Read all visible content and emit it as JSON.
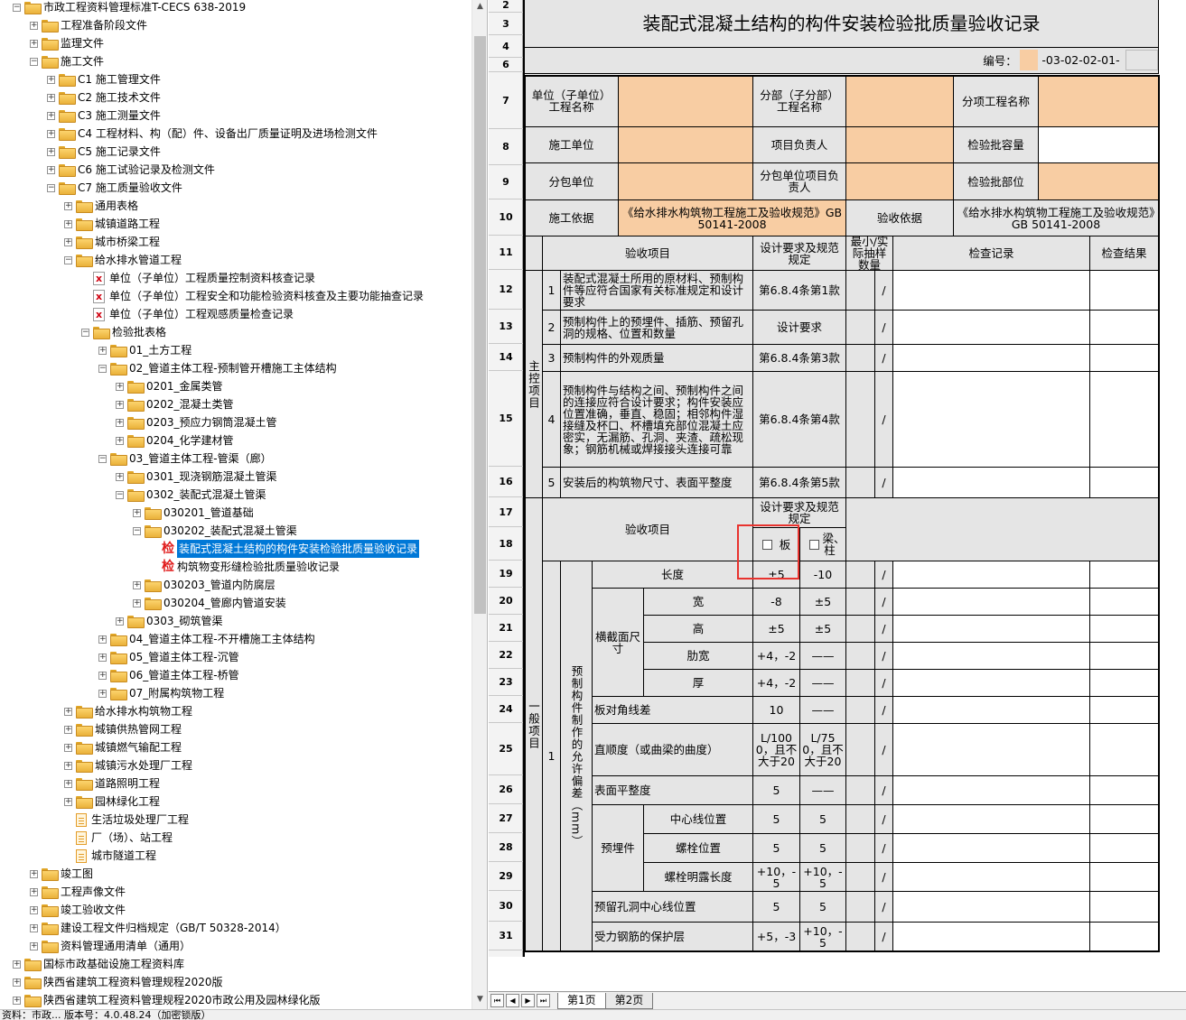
{
  "tree": {
    "items": [
      {
        "label": "市政工程资料管理标准T-CECS 638-2019",
        "depth": 0,
        "exp": "-",
        "icon": "folder"
      },
      {
        "label": "工程准备阶段文件",
        "depth": 1,
        "exp": "+",
        "icon": "folder"
      },
      {
        "label": "监理文件",
        "depth": 1,
        "exp": "+",
        "icon": "folder"
      },
      {
        "label": "施工文件",
        "depth": 1,
        "exp": "-",
        "icon": "folder"
      },
      {
        "label": "C1 施工管理文件",
        "depth": 2,
        "exp": "+",
        "icon": "folder"
      },
      {
        "label": "C2 施工技术文件",
        "depth": 2,
        "exp": "+",
        "icon": "folder"
      },
      {
        "label": "C3 施工测量文件",
        "depth": 2,
        "exp": "+",
        "icon": "folder"
      },
      {
        "label": "C4 工程材料、构（配）件、设备出厂质量证明及进场检测文件",
        "depth": 2,
        "exp": "+",
        "icon": "folder"
      },
      {
        "label": "C5 施工记录文件",
        "depth": 2,
        "exp": "+",
        "icon": "folder"
      },
      {
        "label": "C6 施工试验记录及检测文件",
        "depth": 2,
        "exp": "+",
        "icon": "folder"
      },
      {
        "label": "C7 施工质量验收文件",
        "depth": 2,
        "exp": "-",
        "icon": "folder"
      },
      {
        "label": "通用表格",
        "depth": 3,
        "exp": "+",
        "icon": "folder"
      },
      {
        "label": "城镇道路工程",
        "depth": 3,
        "exp": "+",
        "icon": "folder"
      },
      {
        "label": "城市桥梁工程",
        "depth": 3,
        "exp": "+",
        "icon": "folder"
      },
      {
        "label": "给水排水管道工程",
        "depth": 3,
        "exp": "-",
        "icon": "folder"
      },
      {
        "label": "单位（子单位）工程质量控制资料核查记录",
        "depth": 4,
        "exp": "",
        "icon": "docx"
      },
      {
        "label": "单位（子单位）工程安全和功能检验资料核查及主要功能抽查记录",
        "depth": 4,
        "exp": "",
        "icon": "docx"
      },
      {
        "label": "单位（子单位）工程观感质量检查记录",
        "depth": 4,
        "exp": "",
        "icon": "docx"
      },
      {
        "label": "检验批表格",
        "depth": 4,
        "exp": "-",
        "icon": "folder"
      },
      {
        "label": "01_土方工程",
        "depth": 5,
        "exp": "+",
        "icon": "folder"
      },
      {
        "label": "02_管道主体工程-预制管开槽施工主体结构",
        "depth": 5,
        "exp": "-",
        "icon": "folder"
      },
      {
        "label": "0201_金属类管",
        "depth": 6,
        "exp": "+",
        "icon": "folder"
      },
      {
        "label": "0202_混凝土类管",
        "depth": 6,
        "exp": "+",
        "icon": "folder"
      },
      {
        "label": "0203_预应力钢筒混凝土管",
        "depth": 6,
        "exp": "+",
        "icon": "folder"
      },
      {
        "label": "0204_化学建材管",
        "depth": 6,
        "exp": "+",
        "icon": "folder"
      },
      {
        "label": "03_管道主体工程-管渠（廊）",
        "depth": 5,
        "exp": "-",
        "icon": "folder"
      },
      {
        "label": "0301_现浇钢筋混凝土管渠",
        "depth": 6,
        "exp": "+",
        "icon": "folder"
      },
      {
        "label": "0302_装配式混凝土管渠",
        "depth": 6,
        "exp": "-",
        "icon": "folder"
      },
      {
        "label": "030201_管道基础",
        "depth": 7,
        "exp": "+",
        "icon": "folder"
      },
      {
        "label": "030202_装配式混凝土管渠",
        "depth": 7,
        "exp": "-",
        "icon": "folder"
      },
      {
        "label": "装配式混凝土结构的构件安装检验批质量验收记录",
        "depth": 8,
        "exp": "",
        "icon": "jian",
        "selected": true
      },
      {
        "label": "构筑物变形缝检验批质量验收记录",
        "depth": 8,
        "exp": "",
        "icon": "jian"
      },
      {
        "label": "030203_管道内防腐层",
        "depth": 7,
        "exp": "+",
        "icon": "folder"
      },
      {
        "label": "030204_管廊内管道安装",
        "depth": 7,
        "exp": "+",
        "icon": "folder"
      },
      {
        "label": "0303_砌筑管渠",
        "depth": 6,
        "exp": "+",
        "icon": "folder"
      },
      {
        "label": "04_管道主体工程-不开槽施工主体结构",
        "depth": 5,
        "exp": "+",
        "icon": "folder"
      },
      {
        "label": "05_管道主体工程-沉管",
        "depth": 5,
        "exp": "+",
        "icon": "folder"
      },
      {
        "label": "06_管道主体工程-桥管",
        "depth": 5,
        "exp": "+",
        "icon": "folder"
      },
      {
        "label": "07_附属构筑物工程",
        "depth": 5,
        "exp": "+",
        "icon": "folder"
      },
      {
        "label": "给水排水构筑物工程",
        "depth": 3,
        "exp": "+",
        "icon": "folder"
      },
      {
        "label": "城镇供热管网工程",
        "depth": 3,
        "exp": "+",
        "icon": "folder"
      },
      {
        "label": "城镇燃气输配工程",
        "depth": 3,
        "exp": "+",
        "icon": "folder"
      },
      {
        "label": "城镇污水处理厂工程",
        "depth": 3,
        "exp": "+",
        "icon": "folder"
      },
      {
        "label": "道路照明工程",
        "depth": 3,
        "exp": "+",
        "icon": "folder"
      },
      {
        "label": "园林绿化工程",
        "depth": 3,
        "exp": "+",
        "icon": "folder"
      },
      {
        "label": "生活垃圾处理厂工程",
        "depth": 3,
        "exp": "",
        "icon": "doc"
      },
      {
        "label": "厂（场）、站工程",
        "depth": 3,
        "exp": "",
        "icon": "doc"
      },
      {
        "label": "城市隧道工程",
        "depth": 3,
        "exp": "",
        "icon": "doc"
      },
      {
        "label": "竣工图",
        "depth": 1,
        "exp": "+",
        "icon": "folder"
      },
      {
        "label": "工程声像文件",
        "depth": 1,
        "exp": "+",
        "icon": "folder"
      },
      {
        "label": "竣工验收文件",
        "depth": 1,
        "exp": "+",
        "icon": "folder"
      },
      {
        "label": "建设工程文件归档规定（GB/T 50328-2014）",
        "depth": 1,
        "exp": "+",
        "icon": "folder"
      },
      {
        "label": "资料管理通用清单（通用）",
        "depth": 1,
        "exp": "+",
        "icon": "folder"
      },
      {
        "label": "国标市政基础设施工程资料库",
        "depth": 0,
        "exp": "+",
        "icon": "folder"
      },
      {
        "label": "陕西省建筑工程资料管理规程2020版",
        "depth": 0,
        "exp": "+",
        "icon": "folder"
      },
      {
        "label": "陕西省建筑工程资料管理规程2020市政公用及园林绿化版",
        "depth": 0,
        "exp": "+",
        "icon": "folder"
      }
    ]
  },
  "sheet": {
    "rows": [
      "2",
      "3",
      "4",
      "6",
      "7",
      "8",
      "9",
      "10",
      "11",
      "12",
      "13",
      "14",
      "15",
      "16",
      "17",
      "18",
      "19",
      "20",
      "21",
      "22",
      "23",
      "24",
      "25",
      "26",
      "27",
      "28",
      "29",
      "30",
      "31"
    ],
    "title": "装配式混凝土结构的构件安装检验批质量验收记录",
    "code_label": "编号：",
    "code_value": "-03-02-02-01-",
    "hdr": {
      "unit_name": "单位（子单位）工程名称",
      "sub_name": "分部（子分部）工程名称",
      "item_name": "分项工程名称",
      "contractor": "施工单位",
      "pm": "项目负责人",
      "lot_capacity": "检验批容量",
      "subcontractor": "分包单位",
      "sub_pm": "分包单位项目负责人",
      "lot_location": "检验批部位",
      "basis": "施工依据",
      "basis_value": "《给水排水构筑物工程施工及验收规范》GB 50141-2008",
      "acc_basis": "验收依据",
      "acc_basis_value": "《给水排水构筑物工程施工及验收规范》GB 50141-2008"
    },
    "cols": {
      "item": "验收项目",
      "req": "设计要求及规范规定",
      "sample": "最小/实际抽样数量",
      "record": "检查记录",
      "result": "检查结果"
    },
    "main_label": "主控项目",
    "general_label": "一般项目",
    "main": [
      {
        "no": "1",
        "text": "装配式混凝土所用的原材料、预制构件等应符合国家有关标准规定和设计要求",
        "req": "第6.8.4条第1款",
        "slash": "/"
      },
      {
        "no": "2",
        "text": "预制构件上的预埋件、插筋、预留孔洞的规格、位置和数量",
        "req": "设计要求",
        "slash": "/"
      },
      {
        "no": "3",
        "text": "预制构件的外观质量",
        "req": "第6.8.4条第3款",
        "slash": "/"
      },
      {
        "no": "4",
        "text": "预制构件与结构之间、预制构件之间的连接应符合设计要求；构件安装应位置准确，垂直、稳固；相邻构件湿接缝及杯口、杯槽填充部位混凝土应密实，无漏筋、孔洞、夹渣、疏松现象；钢筋机械或焊接接头连接可靠",
        "req": "第6.8.4条第4款",
        "slash": "/"
      },
      {
        "no": "5",
        "text": "安装后的构筑物尺寸、表面平整度",
        "req": "第6.8.4条第5款",
        "slash": "/"
      }
    ],
    "general": {
      "item_header": "验收项目",
      "req_header": "设计要求及规范规定",
      "plate": "板",
      "beam": "梁、柱",
      "no": "1",
      "group": "预制构件制作的允许偏差（mm）",
      "cross_section": "横截面尺寸",
      "embedded": "预埋件",
      "rows": [
        {
          "label": "长度",
          "a": "±5",
          "b": "-10",
          "slash": "/"
        },
        {
          "label": "宽",
          "a": "-8",
          "b": "±5",
          "slash": "/"
        },
        {
          "label": "高",
          "a": "±5",
          "b": "±5",
          "slash": "/"
        },
        {
          "label": "肋宽",
          "a": "+4，-2",
          "b": "——",
          "slash": "/"
        },
        {
          "label": "厚",
          "a": "+4，-2",
          "b": "——",
          "slash": "/"
        },
        {
          "label": "板对角线差",
          "a": "10",
          "b": "——",
          "slash": "/"
        },
        {
          "label": "直顺度（或曲梁的曲度）",
          "a": "L/1000，且不大于20",
          "b": "L/750，且不大于20",
          "slash": "/"
        },
        {
          "label": "表面平整度",
          "a": "5",
          "b": "——",
          "slash": "/"
        },
        {
          "label": "中心线位置",
          "a": "5",
          "b": "5",
          "slash": "/"
        },
        {
          "label": "螺栓位置",
          "a": "5",
          "b": "5",
          "slash": "/"
        },
        {
          "label": "螺栓明露长度",
          "a": "+10，-5",
          "b": "+10，-5",
          "slash": "/"
        },
        {
          "label": "预留孔洞中心线位置",
          "a": "5",
          "b": "5",
          "slash": "/"
        },
        {
          "label": "受力钢筋的保护层",
          "a": "+5，-3",
          "b": "+10，-5",
          "slash": "/"
        }
      ]
    }
  },
  "tabs": {
    "nav": [
      "⏮",
      "◀",
      "▶",
      "⏭"
    ],
    "items": [
      "第1页",
      "第2页"
    ]
  },
  "status": "资料：市政... 版本号：4.0.48.24（加密锁版）"
}
